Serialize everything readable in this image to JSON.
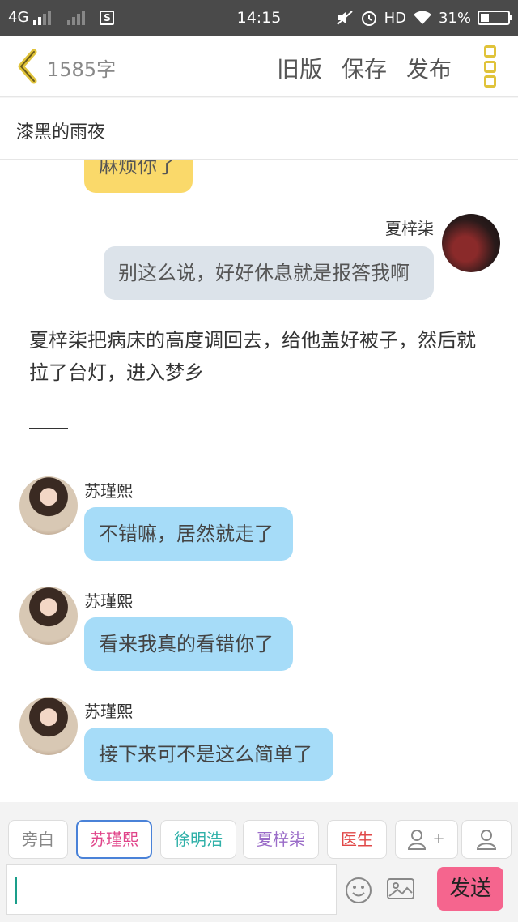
{
  "status_bar": {
    "network": "4G",
    "time": "14:15",
    "hd": "HD",
    "battery": "31%"
  },
  "toolbar": {
    "word_count": "1585字",
    "old_version": "旧版",
    "save": "保存",
    "publish": "发布"
  },
  "story": {
    "title": "漆黑的雨夜"
  },
  "messages": [
    {
      "speaker": "",
      "text": "麻烦你了"
    },
    {
      "speaker": "夏梓柒",
      "text": "别这么说，好好休息就是报答我啊"
    },
    {
      "narration": "夏梓柒把病床的高度调回去，给他盖好被子，然后就拉了台灯，进入梦乡"
    },
    {
      "speaker": "苏瑾熙",
      "text": "不错嘛，居然就走了"
    },
    {
      "speaker": "苏瑾熙",
      "text": "看来我真的看错你了"
    },
    {
      "speaker": "苏瑾熙",
      "text": "接下来可不是这么简单了"
    }
  ],
  "roles": {
    "narrator": "旁白",
    "su": "苏瑾熙",
    "xu": "徐明浩",
    "xia": "夏梓柒",
    "doctor": "医生",
    "add_role_plus": "+"
  },
  "role_colors": {
    "narrator": "#888888",
    "su": "#e0458a",
    "xu": "#2fb0a8",
    "xia": "#9a6cc8",
    "doctor": "#e04848"
  },
  "composer": {
    "input_value": "",
    "send": "发送"
  },
  "colors": {
    "accent_yellow": "#e0c33a",
    "bubble_yellow": "#fad96a",
    "bubble_gray": "#dce3ea",
    "bubble_blue": "#a6dcf8",
    "send_button": "#f5658e",
    "selected_chip_border": "#4a82d8"
  },
  "icons": [
    "back-chevron-icon",
    "more-menu-icon",
    "emoji-icon",
    "image-icon",
    "add-role-icon",
    "person-icon"
  ]
}
